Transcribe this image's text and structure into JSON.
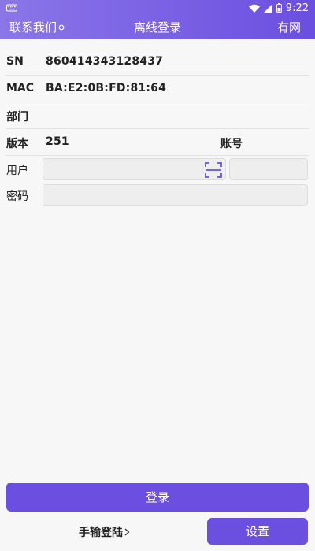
{
  "status_bar": {
    "time": "9:22",
    "icons": [
      "keyboard-icon",
      "wifi-icon",
      "signal-icon",
      "battery-icon"
    ]
  },
  "header": {
    "contact_label": "联系我们",
    "title": "离线登录",
    "network_status": "有网"
  },
  "device": {
    "sn_label": "SN",
    "sn_value": "860414343128437",
    "mac_label": "MAC",
    "mac_value": "BA:E2:0B:FD:81:64",
    "department_label": "部门",
    "department_value": "",
    "version_label": "版本",
    "version_value": "251",
    "account_label": "账号"
  },
  "form": {
    "user_label": "用户",
    "user_value": "",
    "account_value": "",
    "password_label": "密码",
    "password_value": ""
  },
  "actions": {
    "login_label": "登录",
    "manual_login_label": "手输登陆",
    "settings_label": "设置"
  },
  "colors": {
    "accent": "#6a4fe0",
    "accent_light": "#8b76e8"
  }
}
